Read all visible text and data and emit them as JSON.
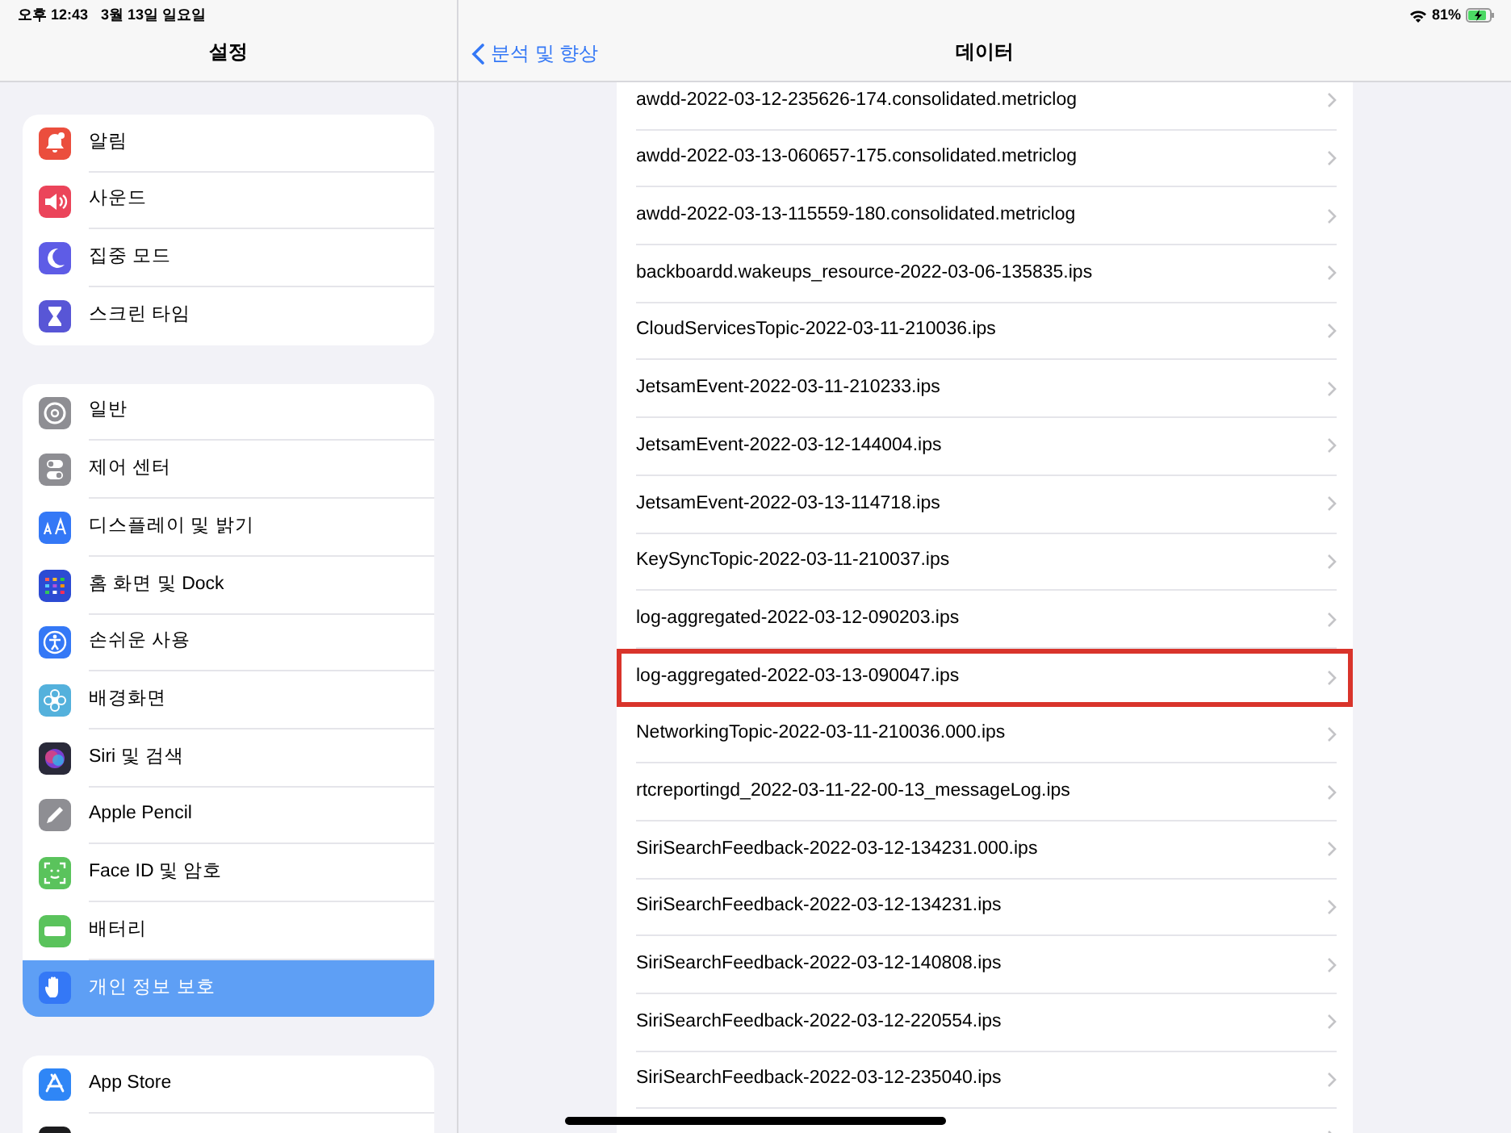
{
  "status_bar": {
    "time": "오후 12:43",
    "date": "3월 13일 일요일",
    "battery": "81%"
  },
  "sidebar": {
    "title": "설정",
    "groups": [
      {
        "items": [
          {
            "label": "알림",
            "color": "#eb4e3d",
            "selected": false
          },
          {
            "label": "사운드",
            "color": "#eb445a",
            "selected": false
          },
          {
            "label": "집중 모드",
            "color": "#5e5ce6",
            "selected": false
          },
          {
            "label": "스크린 타임",
            "color": "#5856d6",
            "selected": false
          }
        ]
      },
      {
        "items": [
          {
            "label": "일반",
            "color": "#8e8e93",
            "selected": false
          },
          {
            "label": "제어 센터",
            "color": "#8e8e93",
            "selected": false
          },
          {
            "label": "디스플레이 및 밝기",
            "color": "#3478f6",
            "selected": false
          },
          {
            "label": "홈 화면 및 Dock",
            "color": "#2c4bd3",
            "selected": false
          },
          {
            "label": "손쉬운 사용",
            "color": "#3478f6",
            "selected": false
          },
          {
            "label": "배경화면",
            "color": "#54b1dc",
            "selected": false
          },
          {
            "label": "Siri 및 검색",
            "color": "#2a2a3a",
            "selected": false
          },
          {
            "label": "Apple Pencil",
            "color": "#8e8e93",
            "selected": false
          },
          {
            "label": "Face ID 및 암호",
            "color": "#5ac35c",
            "selected": false
          },
          {
            "label": "배터리",
            "color": "#5ac35c",
            "selected": false
          },
          {
            "label": "개인 정보 보호",
            "color": "#3478f6",
            "selected": true
          }
        ]
      },
      {
        "items": [
          {
            "label": "App Store",
            "color": "#2f86f6",
            "selected": false
          },
          {
            "color": "#1c1c1e",
            "selected": false
          }
        ]
      }
    ]
  },
  "detail": {
    "back": "분석 및 향상",
    "title": "데이터",
    "rows": [
      {
        "label": "awdd-2022-03-12-235626-174.consolidated.metriclog",
        "highlighted": false
      },
      {
        "label": "awdd-2022-03-13-060657-175.consolidated.metriclog",
        "highlighted": false
      },
      {
        "label": "awdd-2022-03-13-115559-180.consolidated.metriclog",
        "highlighted": false
      },
      {
        "label": "backboardd.wakeups_resource-2022-03-06-135835.ips",
        "highlighted": false
      },
      {
        "label": "CloudServicesTopic-2022-03-11-210036.ips",
        "highlighted": false
      },
      {
        "label": "JetsamEvent-2022-03-11-210233.ips",
        "highlighted": false
      },
      {
        "label": "JetsamEvent-2022-03-12-144004.ips",
        "highlighted": false
      },
      {
        "label": "JetsamEvent-2022-03-13-114718.ips",
        "highlighted": false
      },
      {
        "label": "KeySyncTopic-2022-03-11-210037.ips",
        "highlighted": false
      },
      {
        "label": "log-aggregated-2022-03-12-090203.ips",
        "highlighted": false
      },
      {
        "label": "log-aggregated-2022-03-13-090047.ips",
        "highlighted": true
      },
      {
        "label": "NetworkingTopic-2022-03-11-210036.000.ips",
        "highlighted": false
      },
      {
        "label": "rtcreportingd_2022-03-11-22-00-13_messageLog.ips",
        "highlighted": false
      },
      {
        "label": "SiriSearchFeedback-2022-03-12-134231.000.ips",
        "highlighted": false
      },
      {
        "label": "SiriSearchFeedback-2022-03-12-134231.ips",
        "highlighted": false
      },
      {
        "label": "SiriSearchFeedback-2022-03-12-140808.ips",
        "highlighted": false
      },
      {
        "label": "SiriSearchFeedback-2022-03-12-220554.ips",
        "highlighted": false
      },
      {
        "label": "SiriSearchFeedback-2022-03-12-235040.ips",
        "highlighted": false
      },
      {
        "highlighted": false
      }
    ]
  }
}
